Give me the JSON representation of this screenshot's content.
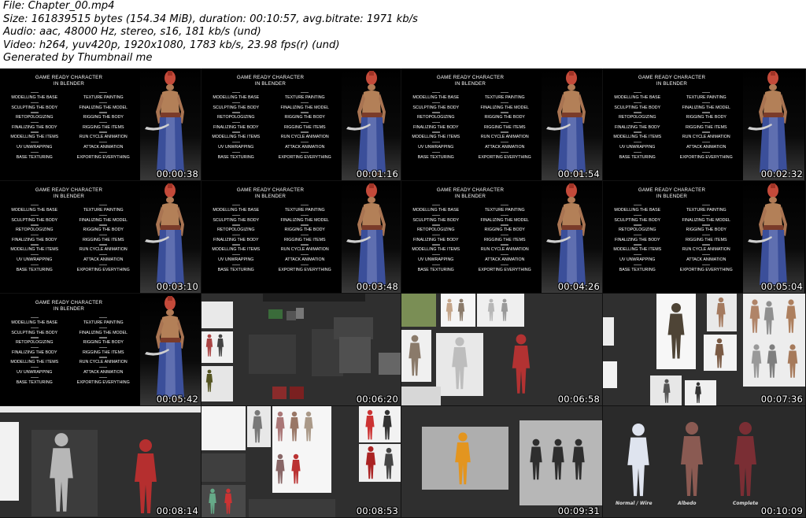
{
  "header": {
    "lines": [
      "File: Chapter_00.mp4",
      "Size: 161839515 bytes (154.34 MiB), duration: 00:10:57, avg.bitrate: 1971 kb/s",
      "Audio: aac, 48000 Hz, stereo, s16, 181 kb/s (und)",
      "Video: h264, yuv420p, 1920x1080, 1783 kb/s, 23.98 fps(r) (und)",
      "Generated by Thumbnail me"
    ]
  },
  "menu": {
    "title_line1": "GAME READY CHARACTER",
    "title_line2": "IN BLENDER",
    "items": [
      "MODELLING THE BASE",
      "TEXTURE PAINTING",
      "SCULPTING THE BODY",
      "FINALIZING THE MODEL",
      "RETOPOLOGIZING",
      "RIGGING THE BODY",
      "FINALIZING THE BODY",
      "RIGGING THE ITEMS",
      "MODELLING THE ITEMS",
      "RUN CYCLE ANIMATION",
      "UV  UNWRAPPING",
      "ATTACK ANIMATION",
      "BASE TEXTURING",
      "EXPORTING EVERYTHING"
    ]
  },
  "thumbnails": [
    {
      "timestamp": "00:00:38",
      "kind": "menu"
    },
    {
      "timestamp": "00:01:16",
      "kind": "menu"
    },
    {
      "timestamp": "00:01:54",
      "kind": "menu"
    },
    {
      "timestamp": "00:02:32",
      "kind": "menu"
    },
    {
      "timestamp": "00:03:10",
      "kind": "menu"
    },
    {
      "timestamp": "00:03:48",
      "kind": "menu"
    },
    {
      "timestamp": "00:04:26",
      "kind": "menu"
    },
    {
      "timestamp": "00:05:04",
      "kind": "menu"
    },
    {
      "timestamp": "00:05:42",
      "kind": "menu"
    },
    {
      "timestamp": "00:06:20",
      "kind": "collage"
    },
    {
      "timestamp": "00:06:58",
      "kind": "collage"
    },
    {
      "timestamp": "00:07:36",
      "kind": "collage"
    },
    {
      "timestamp": "00:08:14",
      "kind": "collage"
    },
    {
      "timestamp": "00:08:53",
      "kind": "collage"
    },
    {
      "timestamp": "00:09:31",
      "kind": "collage"
    },
    {
      "timestamp": "00:10:09",
      "kind": "collage"
    }
  ],
  "labels_1009": {
    "a": "Normal / Wire",
    "b": "Albedo",
    "c": "Complete"
  },
  "colors": {
    "background": "#ffffff",
    "thumb_bg": "#000000",
    "workspace_bg": "#2f2f2f",
    "character_robe": "#3b4f9a",
    "character_head": "#c44a3a"
  }
}
